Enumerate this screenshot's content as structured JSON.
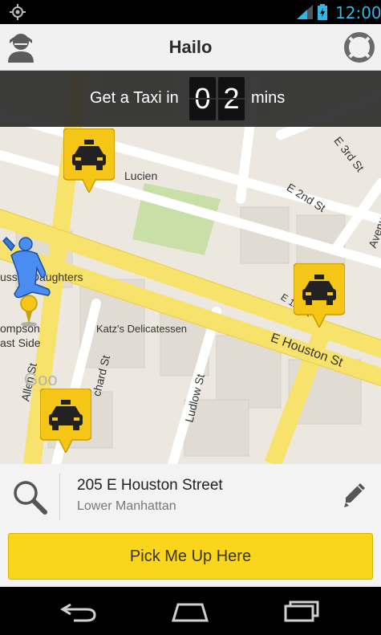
{
  "status_bar": {
    "time": "12:00",
    "icons": [
      "gps-icon",
      "signal-icon",
      "battery-icon"
    ]
  },
  "header": {
    "title": "Hailo",
    "left_icon": "profile-icon",
    "right_icon": "help-lifebuoy-icon"
  },
  "eta": {
    "lead": "Get a Taxi in",
    "digit1": "0",
    "digit2": "2",
    "unit": "mins"
  },
  "map": {
    "labels": {
      "e_3rd": "E 3rd St",
      "e_2nd": "E 2nd St",
      "e_1st": "E 1st St",
      "e_houston": "E Houston St",
      "avenue": "Avenue",
      "lucien": "Lucien",
      "russ": "uss & Daughters",
      "katz": "Katz's Delicatessen",
      "thompson": "ompson",
      "east_side": "ast Side",
      "allen": "Allen St",
      "orchard": "chard St",
      "ludlow": "Ludlow St",
      "google": "Goo"
    },
    "markers": [
      "taxi-marker",
      "taxi-marker",
      "taxi-marker",
      "pickup-person-marker"
    ]
  },
  "address": {
    "street": "205 E Houston Street",
    "area": "Lower Manhattan"
  },
  "pickup_button": "Pick Me Up Here",
  "nav": [
    "back-icon",
    "home-icon",
    "recent-apps-icon"
  ],
  "colors": {
    "accent_yellow": "#f9d51c",
    "status_blue": "#33b5e5",
    "road_yellow": "#f7e26b",
    "map_bg": "#ece8e0",
    "park_green": "#c8dfa8"
  }
}
